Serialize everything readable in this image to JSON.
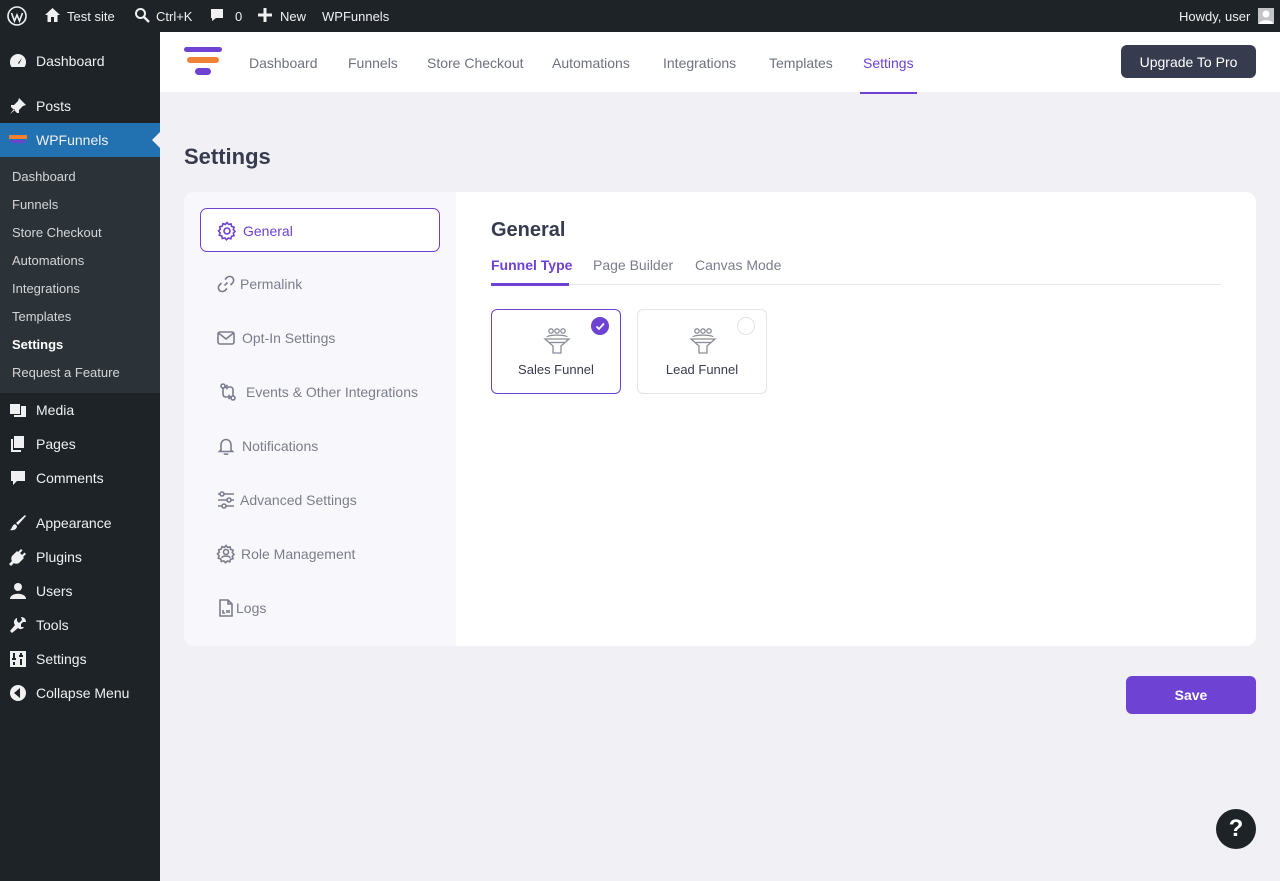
{
  "admin_bar": {
    "site_name": "Test site",
    "search_shortcut": "Ctrl+K",
    "comments_count": "0",
    "new_label": "New",
    "plugin_link": "WPFunnels",
    "greeting": "Howdy, user"
  },
  "sidebar": {
    "items": [
      {
        "label": "Dashboard",
        "icon": "dashboard-icon"
      },
      {
        "label": "Posts",
        "icon": "pin-icon"
      },
      {
        "label": "WPFunnels",
        "icon": "wpfunnels-icon"
      },
      {
        "label": "Media",
        "icon": "media-icon"
      },
      {
        "label": "Pages",
        "icon": "pages-icon"
      },
      {
        "label": "Comments",
        "icon": "comment-icon"
      },
      {
        "label": "Appearance",
        "icon": "brush-icon"
      },
      {
        "label": "Plugins",
        "icon": "plug-icon"
      },
      {
        "label": "Users",
        "icon": "user-icon"
      },
      {
        "label": "Tools",
        "icon": "wrench-icon"
      },
      {
        "label": "Settings",
        "icon": "sliders-icon"
      },
      {
        "label": "Collapse Menu",
        "icon": "collapse-icon"
      }
    ],
    "submenu": [
      "Dashboard",
      "Funnels",
      "Store Checkout",
      "Automations",
      "Integrations",
      "Templates",
      "Settings",
      "Request a Feature"
    ]
  },
  "topnav": {
    "links": [
      "Dashboard",
      "Funnels",
      "Store Checkout",
      "Automations",
      "Integrations",
      "Templates",
      "Settings"
    ],
    "active": "Settings",
    "upgrade_label": "Upgrade To Pro"
  },
  "page": {
    "title": "Settings",
    "settings_tabs": [
      {
        "label": "General",
        "icon": "gear-icon"
      },
      {
        "label": "Permalink",
        "icon": "link-icon"
      },
      {
        "label": "Opt-In Settings",
        "icon": "mail-icon"
      },
      {
        "label": "Events & Other Integrations",
        "icon": "integration-icon"
      },
      {
        "label": "Notifications",
        "icon": "bell-icon"
      },
      {
        "label": "Advanced Settings",
        "icon": "sliders-icon"
      },
      {
        "label": "Role Management",
        "icon": "user-gear-icon"
      },
      {
        "label": "Logs",
        "icon": "file-icon"
      }
    ],
    "active_tab": "General",
    "section_title": "General",
    "inner_tabs": [
      "Funnel Type",
      "Page Builder",
      "Canvas Mode"
    ],
    "active_inner_tab": "Funnel Type",
    "funnel_types": [
      {
        "label": "Sales Funnel",
        "selected": true
      },
      {
        "label": "Lead Funnel",
        "selected": false
      }
    ],
    "save_label": "Save",
    "help_label": "?"
  },
  "colors": {
    "accent": "#6e42d3",
    "dark": "#363b4e",
    "admin_bg": "#1d2327",
    "active_menu": "#2271b1"
  }
}
